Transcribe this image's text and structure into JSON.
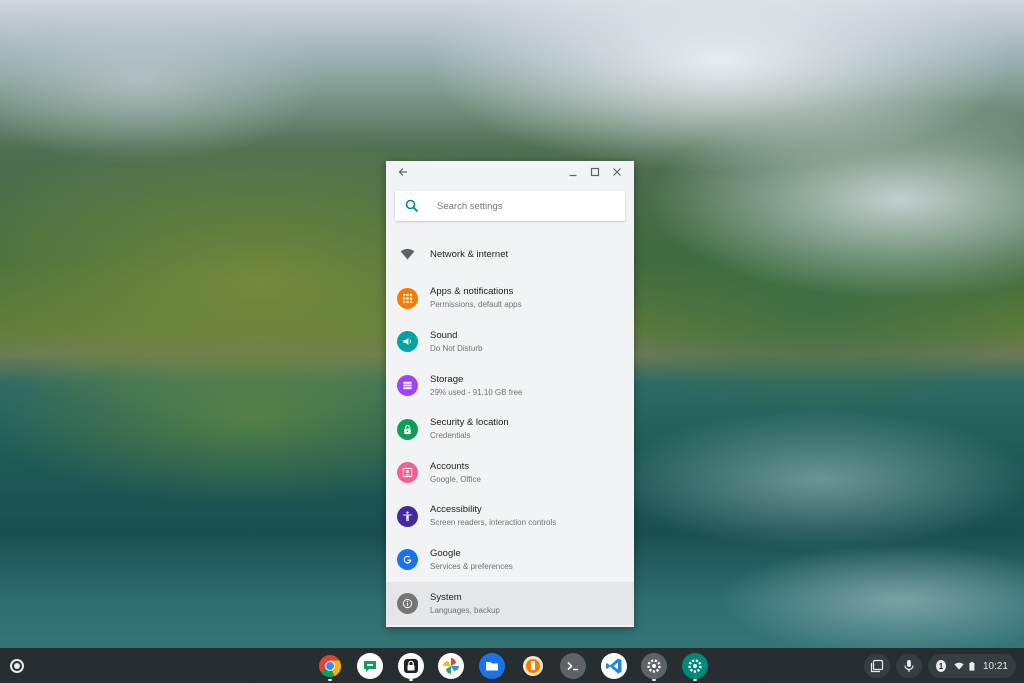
{
  "window": {
    "search_placeholder": "Search settings"
  },
  "settings": [
    {
      "title": "Network & internet",
      "subtitle": "",
      "icon": "wifi-icon",
      "color": "#5f6368"
    },
    {
      "title": "Apps & notifications",
      "subtitle": "Permissions, default apps",
      "icon": "apps-icon",
      "color": "#f57c00"
    },
    {
      "title": "Sound",
      "subtitle": "Do Not Disturb",
      "icon": "volume-icon",
      "color": "#00a3a3"
    },
    {
      "title": "Storage",
      "subtitle": "29% used - 91.10 GB free",
      "icon": "storage-icon",
      "color": "#a142f4"
    },
    {
      "title": "Security & location",
      "subtitle": "Credentials",
      "icon": "lock-icon",
      "color": "#0f9d58"
    },
    {
      "title": "Accounts",
      "subtitle": "Google, Office",
      "icon": "account-icon",
      "color": "#f06292"
    },
    {
      "title": "Accessibility",
      "subtitle": "Screen readers, interaction controls",
      "icon": "accessibility-icon",
      "color": "#4527a0"
    },
    {
      "title": "Google",
      "subtitle": "Services & preferences",
      "icon": "google-icon",
      "color": "#1a73e8"
    },
    {
      "title": "System",
      "subtitle": "Languages, backup",
      "icon": "info-icon",
      "color": "#757575"
    }
  ],
  "shelf": {
    "apps": [
      "chrome-icon",
      "hangouts-chat-icon",
      "secure-shell-icon",
      "photos-icon",
      "files-icon",
      "pixelmator-icon",
      "terminal-icon",
      "vscode-icon",
      "settings-gear-icon",
      "settings-app-icon"
    ],
    "notification_count": "1",
    "time": "10:21"
  }
}
